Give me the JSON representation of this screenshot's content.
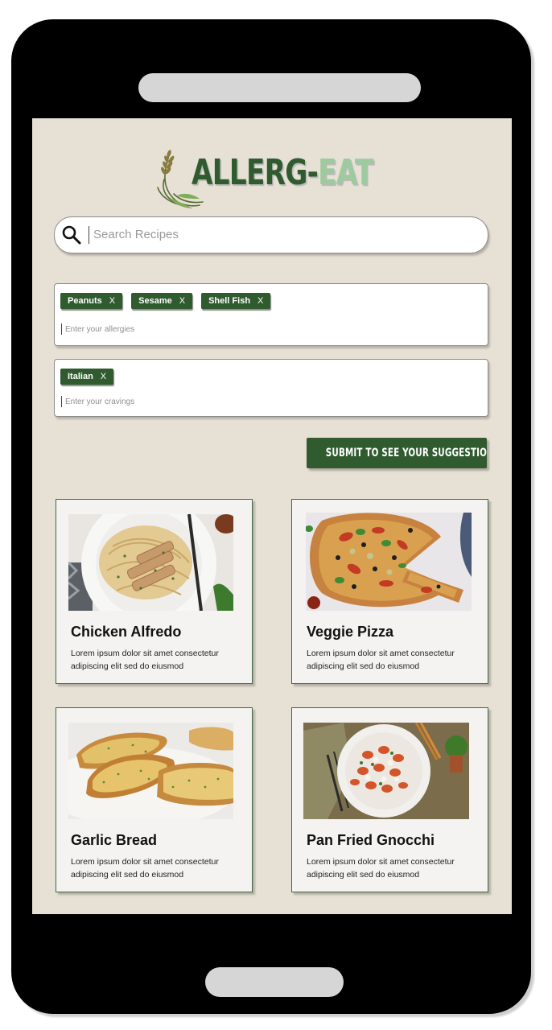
{
  "app": {
    "logo_part1": "ALLERG-",
    "logo_part2": "EAT"
  },
  "search": {
    "placeholder": "Search Recipes"
  },
  "allergies": {
    "tags": [
      {
        "label": "Peanuts",
        "remove": "X"
      },
      {
        "label": "Sesame",
        "remove": "X"
      },
      {
        "label": "Shell Fish",
        "remove": "X"
      }
    ],
    "placeholder": "Enter your allergies"
  },
  "cravings": {
    "tags": [
      {
        "label": "Italian",
        "remove": "X"
      }
    ],
    "placeholder": "Enter your cravings"
  },
  "submit_label": "SUBMIT TO SEE YOUR SUGGESTIONS",
  "recipes": [
    {
      "title": "Chicken Alfredo",
      "description": "Lorem ipsum dolor sit amet consectetur adipiscing elit sed do eiusmod"
    },
    {
      "title": "Veggie Pizza",
      "description": "Lorem ipsum dolor sit amet consectetur adipiscing elit sed do eiusmod"
    },
    {
      "title": "Garlic Bread",
      "description": "Lorem ipsum dolor sit amet consectetur adipiscing elit sed do eiusmod"
    },
    {
      "title": "Pan Fried Gnocchi",
      "description": "Lorem ipsum dolor sit amet consectetur adipiscing elit sed do eiusmod"
    }
  ],
  "colors": {
    "brand_green": "#2f5b2f",
    "brand_light_green": "#9ecb9e",
    "screen_bg": "#e6e0d5"
  },
  "icons": {
    "search": "search-icon",
    "logo": "wheat-icon"
  }
}
